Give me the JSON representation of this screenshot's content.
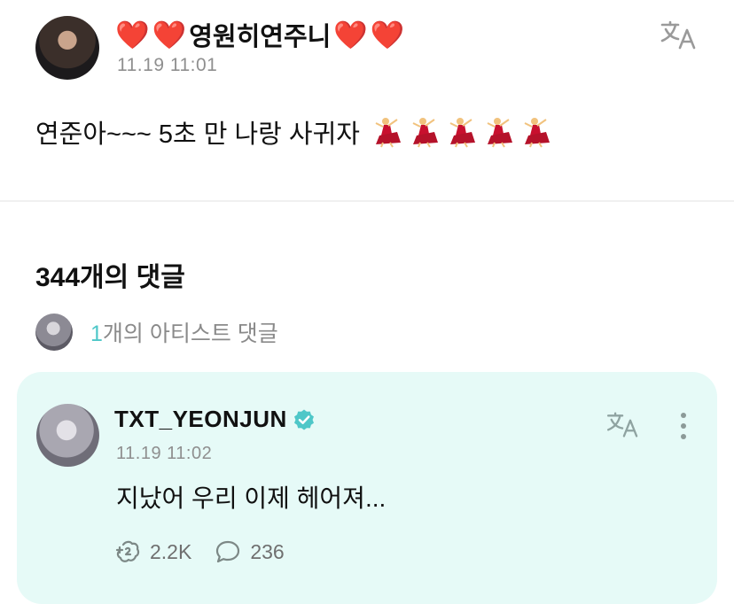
{
  "post": {
    "author_name": "영원히연주니",
    "author_prefix_hearts": [
      "❤️",
      "❤️"
    ],
    "author_suffix_hearts": [
      "❤️",
      "❤️"
    ],
    "timestamp": "11.19 11:01",
    "body_text": "연준아~~~ 5초 만 나랑 사귀자",
    "dancer_emoji_count": 5,
    "translate_icon": "translate-icon"
  },
  "comments_section": {
    "title": "344개의 댓글",
    "artist_comments": {
      "count": "1",
      "label": "개의 아티스트 댓글"
    }
  },
  "comment": {
    "author_name": "TXT_YEONJUN",
    "verified_icon": "verified-badge-icon",
    "timestamp": "11.19 11:02",
    "body_text": "지났어 우리 이제 헤어져...",
    "like_count": "2.2K",
    "reply_count": "236",
    "background_color": "#e6faf7",
    "accent_color": "#4ec7c8"
  }
}
